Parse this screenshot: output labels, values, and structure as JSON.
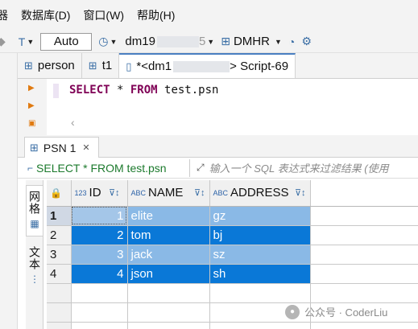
{
  "menubar": {
    "items": [
      {
        "label": "器"
      },
      {
        "label": "数据库(D)"
      },
      {
        "label": "窗口(W)"
      },
      {
        "label": "帮助(H)"
      }
    ]
  },
  "toolbar": {
    "mode_value": "Auto",
    "connection_prefix": "dm19",
    "connection_suffix": "5",
    "schema": "DMHR"
  },
  "editor_tabs": [
    {
      "label": "person",
      "icon": "table-icon"
    },
    {
      "label": "t1",
      "icon": "table-icon"
    },
    {
      "label_prefix": "*<dm1",
      "label_suffix": "> Script-69",
      "icon": "sql-script-icon",
      "active": true
    }
  ],
  "editor": {
    "sql_keyword_1": "SELECT",
    "sql_star": " * ",
    "sql_keyword_2": "FROM",
    "sql_tail": " test.psn"
  },
  "result": {
    "tab_label": "PSN 1",
    "filter_sql": "SELECT * FROM test.psn",
    "filter_placeholder": "输入一个 SQL 表达式来过滤结果 (使用",
    "side_tabs": {
      "grid": "网格",
      "text": "文本"
    },
    "columns": [
      {
        "type": "123",
        "name": "ID"
      },
      {
        "type": "ABC",
        "name": "NAME"
      },
      {
        "type": "ABC",
        "name": "ADDRESS"
      }
    ],
    "rows": [
      {
        "num": "1",
        "id": "1",
        "name": "elite",
        "address": "gz"
      },
      {
        "num": "2",
        "id": "2",
        "name": "tom",
        "address": "bj"
      },
      {
        "num": "3",
        "id": "3",
        "name": "jack",
        "address": "sz"
      },
      {
        "num": "4",
        "id": "4",
        "name": "json",
        "address": "sh"
      }
    ]
  },
  "watermark": {
    "text": "公众号 · CoderLiu"
  },
  "colors": {
    "selection_light": "#8ab9e6",
    "selection_dark": "#0a78d7",
    "keyword": "#7f0055"
  }
}
